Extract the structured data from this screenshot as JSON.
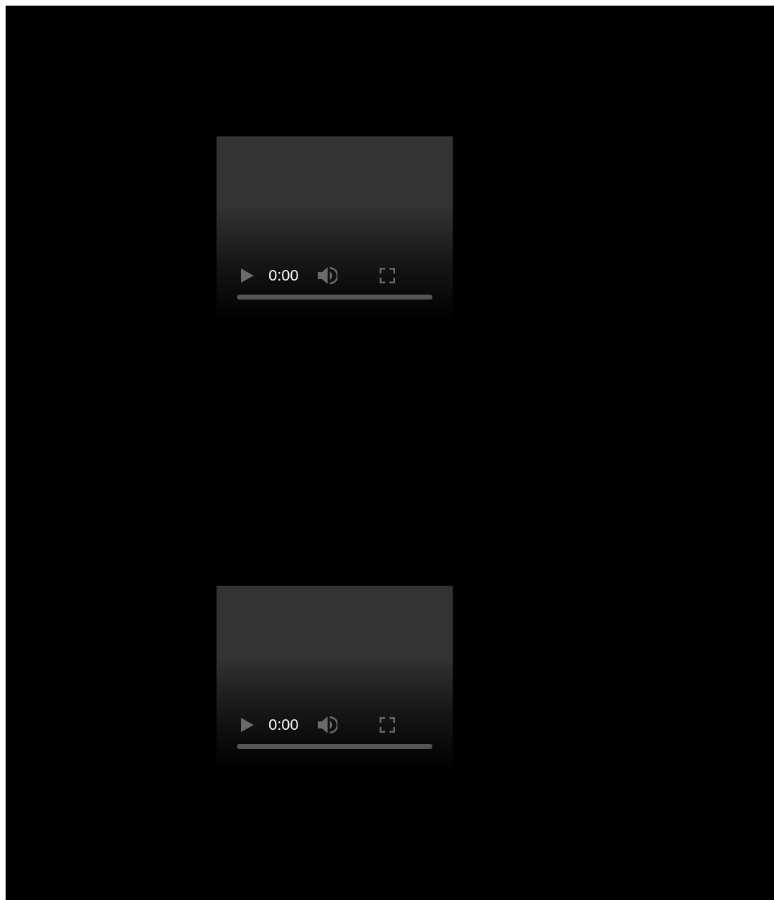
{
  "players": [
    {
      "time": "0:00"
    },
    {
      "time": "0:00"
    }
  ]
}
